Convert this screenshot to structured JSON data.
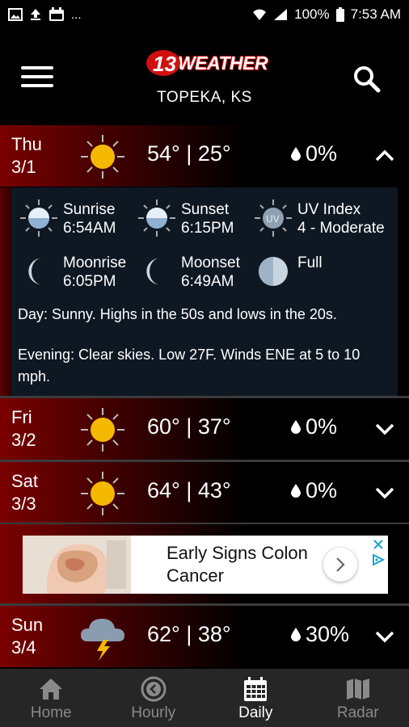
{
  "status_bar": {
    "left_icons": [
      "image-icon",
      "upload-icon",
      "calendar-icon",
      "more-dots-icon"
    ],
    "more": "...",
    "battery": "100%",
    "time": "7:53 AM"
  },
  "header": {
    "logo_number": "13",
    "logo_text": "WEATHER",
    "location": "TOPEKA, KS"
  },
  "days": [
    {
      "day": "Thu",
      "date": "3/1",
      "icon": "sunny-icon",
      "high": "54°",
      "low": "25°",
      "temps": "54° | 25°",
      "precip": "0%",
      "expanded": true
    },
    {
      "day": "Fri",
      "date": "3/2",
      "icon": "sunny-icon",
      "high": "60°",
      "low": "37°",
      "temps": "60° | 37°",
      "precip": "0%",
      "expanded": false
    },
    {
      "day": "Sat",
      "date": "3/3",
      "icon": "sunny-icon",
      "high": "64°",
      "low": "43°",
      "temps": "64° | 43°",
      "precip": "0%",
      "expanded": false
    },
    {
      "day": "Sun",
      "date": "3/4",
      "icon": "thunderstorm-icon",
      "high": "62°",
      "low": "38°",
      "temps": "62° | 38°",
      "precip": "30%",
      "expanded": false
    }
  ],
  "detail": {
    "sunrise_label": "Sunrise",
    "sunrise_time": "6:54AM",
    "sunset_label": "Sunset",
    "sunset_time": "6:15PM",
    "uv_label": "UV Index",
    "uv_value": "4 - Moderate",
    "uv_badge": "UV",
    "moonrise_label": "Moonrise",
    "moonrise_time": "6:05PM",
    "moonset_label": "Moonset",
    "moonset_time": "6:49AM",
    "moon_phase": "Full",
    "day_text": "Day: Sunny. Highs in the 50s and lows in the 20s.",
    "evening_text": "Evening: Clear skies. Low 27F. Winds ENE at 5 to 10 mph."
  },
  "ad": {
    "title": "Early Signs Colon Cancer"
  },
  "nav": [
    {
      "label": "Home",
      "icon": "home-icon",
      "active": false
    },
    {
      "label": "Hourly",
      "icon": "clock-icon",
      "active": false
    },
    {
      "label": "Daily",
      "icon": "calendar-icon",
      "active": true
    },
    {
      "label": "Radar",
      "icon": "map-icon",
      "active": false
    }
  ],
  "colors": {
    "accent_red": "#7a0000",
    "sun_yellow": "#f5b800",
    "panel_bg": "#0e1823",
    "nav_bg": "#262626"
  }
}
